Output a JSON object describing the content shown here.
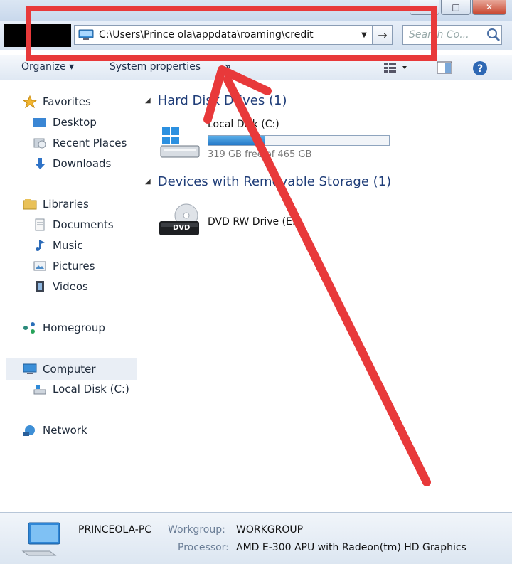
{
  "address": {
    "path": "C:\\Users\\Prince ola\\appdata\\roaming\\credit",
    "go_glyph": "→"
  },
  "search": {
    "placeholder": "Search Co..."
  },
  "window_controls": {
    "minimize": "–",
    "maximize": "□",
    "close": "✕"
  },
  "toolbar": {
    "organize": "Organize ▾",
    "system_properties": "System properties",
    "more": "»"
  },
  "sidebar": {
    "favorites": "Favorites",
    "desktop": "Desktop",
    "recent_places": "Recent Places",
    "downloads": "Downloads",
    "libraries": "Libraries",
    "documents": "Documents",
    "music": "Music",
    "pictures": "Pictures",
    "videos": "Videos",
    "homegroup": "Homegroup",
    "computer": "Computer",
    "local_disk": "Local Disk (C:)",
    "network": "Network"
  },
  "content": {
    "hard_disk_header": "Hard Disk Drives (1)",
    "local_disk_name": "Local Disk (C:)",
    "local_disk_space": "319 GB free of 465 GB",
    "local_disk_used_fraction": 0.314,
    "removable_header": "Devices with Removable Storage (1)",
    "dvd_name": "DVD RW Drive (E:)",
    "dvd_label": "DVD"
  },
  "details": {
    "computer_name": "PRINCEOLA-PC",
    "workgroup_label": "Workgroup:",
    "workgroup_value": "WORKGROUP",
    "processor_label": "Processor:",
    "processor_value": "AMD E-300 APU with Radeon(tm) HD Graphics"
  },
  "colors": {
    "annotation_red": "#e8393a",
    "header_blue": "#1f3d78"
  },
  "icons": {
    "address_icon": "computer-icon",
    "search_icon": "magnifier-icon",
    "help_icon": "help-icon"
  }
}
